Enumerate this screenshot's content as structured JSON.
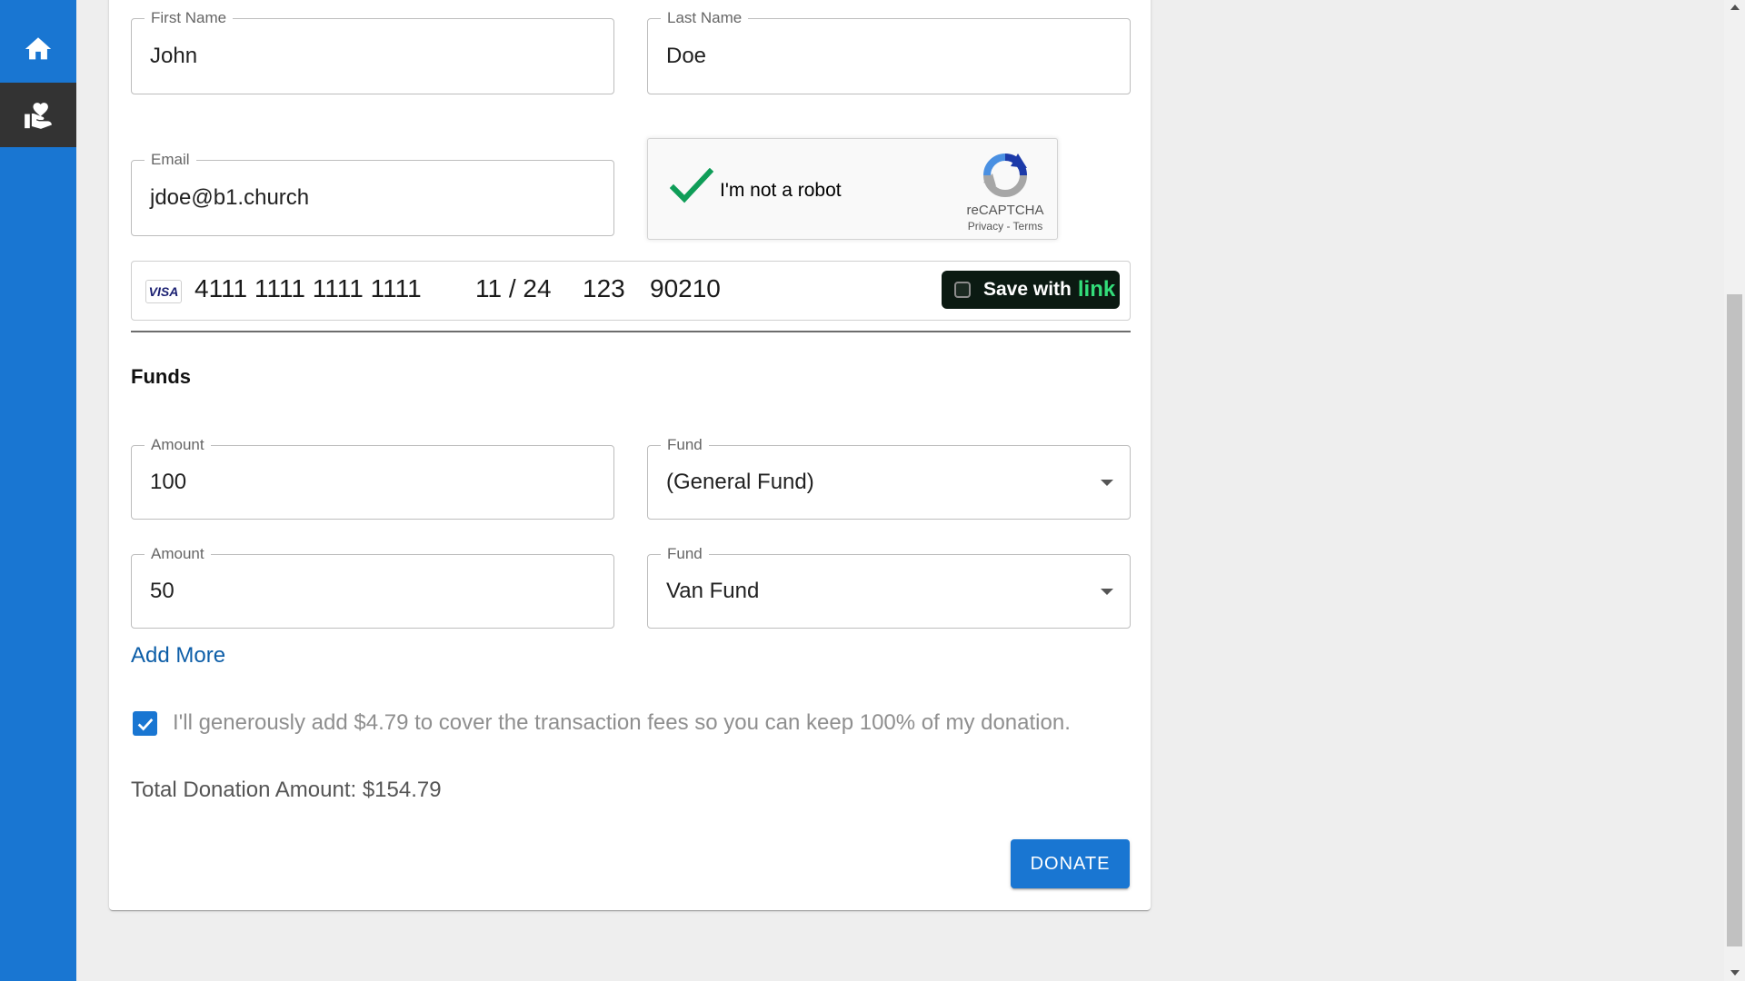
{
  "sidebar": {
    "items": [
      {
        "icon": "home-icon",
        "active": false
      },
      {
        "icon": "donate-hand-heart-icon",
        "active": true
      }
    ]
  },
  "form": {
    "first_name": {
      "label": "First Name",
      "value": "John"
    },
    "last_name": {
      "label": "Last Name",
      "value": "Doe"
    },
    "email": {
      "label": "Email",
      "value": "jdoe@b1.church"
    }
  },
  "captcha": {
    "label": "I'm not a robot",
    "brand": "reCAPTCHA",
    "links": "Privacy - Terms",
    "checked": true
  },
  "card": {
    "brand": "VISA",
    "number": "4111 1111 1111 1111",
    "expiry": "11 / 24",
    "cvc": "123",
    "zip": "90210",
    "link_label": "Save with",
    "link_brand": "link"
  },
  "funds": {
    "title": "Funds",
    "rows": [
      {
        "amount_label": "Amount",
        "amount": "100",
        "fund_label": "Fund",
        "fund": "(General Fund)"
      },
      {
        "amount_label": "Amount",
        "amount": "50",
        "fund_label": "Fund",
        "fund": "Van Fund"
      }
    ],
    "add_more": "Add More"
  },
  "fees": {
    "checked": true,
    "text": "I'll generously add $4.79 to cover the transaction fees so you can keep 100% of my donation."
  },
  "total": "Total Donation Amount: $154.79",
  "donate_label": "DONATE",
  "colors": {
    "primary": "#1976d2",
    "sidebar_active": "#333333",
    "link_button_bg": "#0b1a12",
    "link_green": "#33dd7a",
    "captcha_check": "#0f9d58"
  }
}
